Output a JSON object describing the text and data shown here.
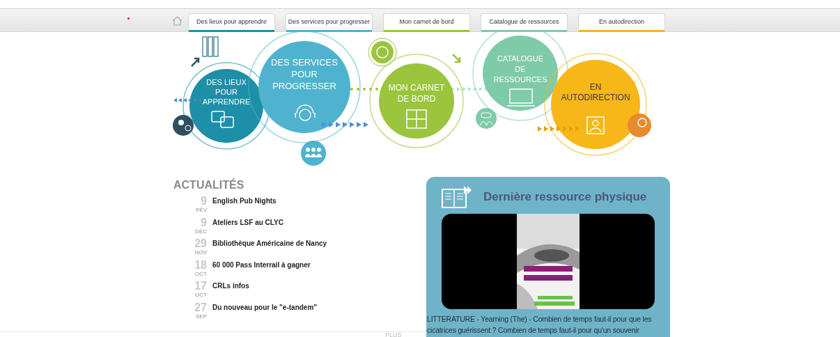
{
  "tabs": [
    {
      "label": "Des lieux pour apprendre",
      "color": "#1e8fa8"
    },
    {
      "label": "Des services pour progresser",
      "color": "#4fb3cf"
    },
    {
      "label": "Mon carnet de bord",
      "color": "#9bc53d"
    },
    {
      "label": "Catalogue de ressources",
      "color": "#7fcba9"
    },
    {
      "label": "En autodirection",
      "color": "#f7b718"
    }
  ],
  "diagram": {
    "circles": [
      {
        "lines": [
          "DES LIEUX",
          "POUR",
          "APPRENDRE"
        ],
        "color": "#1e8fa8"
      },
      {
        "lines": [
          "DES SERVICES",
          "POUR",
          "PROGRESSER"
        ],
        "color": "#4fb3cf"
      },
      {
        "lines": [
          "MON CARNET",
          "DE BORD"
        ],
        "color": "#9bc53d"
      },
      {
        "lines": [
          "CATALOGUE",
          "DE",
          "RESSOURCES"
        ],
        "color": "#7fcba9"
      },
      {
        "lines": [
          "EN",
          "AUTODIRECTION"
        ],
        "color": "#f7b718"
      }
    ]
  },
  "news": {
    "title": "ACTUALITÉS",
    "items": [
      {
        "day": "9",
        "month": "FÉV",
        "title": "English Pub Nights"
      },
      {
        "day": "9",
        "month": "DÉC",
        "title": "Ateliers LSF au CLYC"
      },
      {
        "day": "29",
        "month": "NOV",
        "title": "Bibliothèque Américaine de Nancy"
      },
      {
        "day": "18",
        "month": "OCT",
        "title": "60 000 Pass Interrail à gagner"
      },
      {
        "day": "17",
        "month": "OCT",
        "title": "CRLs infos"
      },
      {
        "day": "27",
        "month": "SEP",
        "title": "Du nouveau pour le \"e-tandem\""
      }
    ],
    "more": "PLUS"
  },
  "resource": {
    "title": "Dernière ressource physique",
    "description": "LITTERATURE - Yearning (The) - Combien de temps faut-il pour que les cicatrices guérissent ? Combien de temps faut-il pour qu'un souvenir"
  }
}
